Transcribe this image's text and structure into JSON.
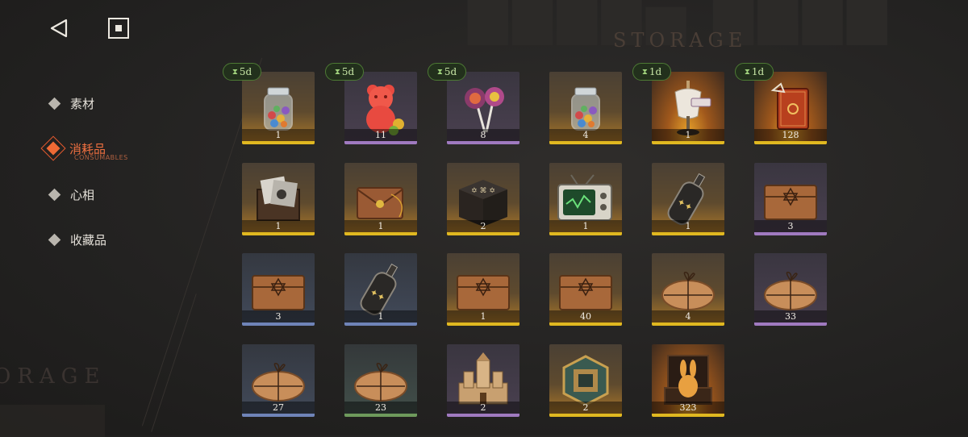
{
  "background": {
    "storage_label_top": "STORAGE",
    "storage_label_left": "ORAGE"
  },
  "nav": {
    "back_icon": "triangle-back-icon",
    "home_icon": "square-home-icon"
  },
  "menu": {
    "items": [
      {
        "label": "素材",
        "active": false
      },
      {
        "label": "消耗品",
        "sub": "CONSUMABLES",
        "active": true
      },
      {
        "label": "心相",
        "active": false
      },
      {
        "label": "收藏品",
        "active": false
      }
    ]
  },
  "colors": {
    "accent": "#f06a35",
    "rarity_gold": "#e0b820",
    "rarity_purple": "#a07ac0",
    "rarity_blue": "#6f84b8",
    "rarity_green": "#6e9a5c",
    "timer_green": "#4d7a34"
  },
  "inventory": {
    "items": [
      {
        "icon": "candy-jar-icon",
        "count": "1",
        "timer": "5d",
        "rarity": "gold"
      },
      {
        "icon": "gummy-bear-icon",
        "count": "11",
        "timer": "5d",
        "rarity": "purple"
      },
      {
        "icon": "lollipops-icon",
        "count": "8",
        "timer": "5d",
        "rarity": "purple"
      },
      {
        "icon": "candy-jar-icon",
        "count": "4",
        "timer": "",
        "rarity": "gold"
      },
      {
        "icon": "mannequin-icon",
        "count": "1",
        "timer": "1d",
        "rarity": "gold"
      },
      {
        "icon": "red-book-icon",
        "count": "128",
        "timer": "1d",
        "rarity": "gold"
      },
      {
        "icon": "photo-chest-icon",
        "count": "1",
        "timer": "",
        "rarity": "gold"
      },
      {
        "icon": "envelope-icon",
        "count": "1",
        "timer": "",
        "rarity": "gold"
      },
      {
        "icon": "rune-box-icon",
        "count": "2",
        "timer": "",
        "rarity": "gold"
      },
      {
        "icon": "old-tv-icon",
        "count": "1",
        "timer": "",
        "rarity": "gold"
      },
      {
        "icon": "bottle-icon",
        "count": "1",
        "timer": "",
        "rarity": "gold"
      },
      {
        "icon": "wooden-crate-icon",
        "count": "3",
        "timer": "",
        "rarity": "purple"
      },
      {
        "icon": "wooden-crate-icon",
        "count": "3",
        "timer": "",
        "rarity": "blue"
      },
      {
        "icon": "bottle-icon",
        "count": "1",
        "timer": "",
        "rarity": "blue"
      },
      {
        "icon": "wooden-crate-icon",
        "count": "1",
        "timer": "",
        "rarity": "gold"
      },
      {
        "icon": "wooden-crate-icon",
        "count": "40",
        "timer": "",
        "rarity": "gold"
      },
      {
        "icon": "parcel-icon",
        "count": "4",
        "timer": "",
        "rarity": "gold"
      },
      {
        "icon": "parcel-icon",
        "count": "33",
        "timer": "",
        "rarity": "purple"
      },
      {
        "icon": "parcel-icon",
        "count": "27",
        "timer": "",
        "rarity": "blue"
      },
      {
        "icon": "parcel-icon",
        "count": "23",
        "timer": "",
        "rarity": "green"
      },
      {
        "icon": "sand-castle-icon",
        "count": "2",
        "timer": "",
        "rarity": "purple"
      },
      {
        "icon": "badge-icon",
        "count": "2",
        "timer": "",
        "rarity": "gold"
      },
      {
        "icon": "rabbit-box-icon",
        "count": "323",
        "timer": "",
        "rarity": "gold"
      }
    ]
  }
}
